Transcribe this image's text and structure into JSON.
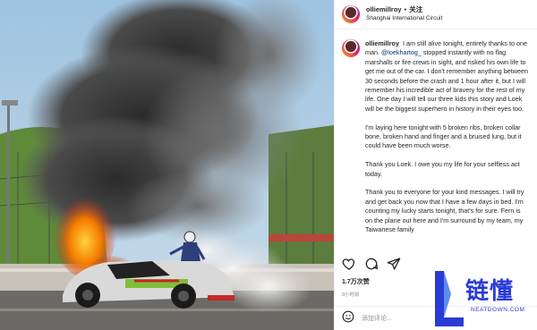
{
  "post": {
    "username": "olliemillroy",
    "follow_label": "关注",
    "separator": "•",
    "location": "Shanghai International Circuit",
    "caption": {
      "username": "olliemillroy",
      "part1_before": "I am still alive tonight, entirely thanks to one man.",
      "mention": "@loekhartog_",
      "part1_after": "stopped instantly with no flag marshalls or fire crews in sight, and risked his own life to get me out of the car. I don't remember anything between 30 seconds before the crash and 1 hour after it, but I will remember his incredible act of bravery for the rest of my life. One day I will tell our three kids this story and Loek will be the biggest superhero in history in their eyes too.",
      "paragraph2": "I'm laying here tonight with 5 broken ribs, broken collar bone, broken hand and finger and a bruised lung, but it could have been much worse.",
      "paragraph3": "Thank you Loek. I owe you my life for your selfless act today.",
      "paragraph4": "Thank you to everyone for your kind messages. I will try and get back you now that I have a few days in bed. I'm counting my lucky starts tonight, that's for sure. Fern is on the plane out here and I'm surround by my team, my Taiwanese family"
    },
    "likes": "1.7万次赞",
    "time_ago": "8小时前",
    "comment_placeholder": "添加评论..."
  },
  "icons": {
    "like": "heart-icon",
    "comment": "comment-icon",
    "share": "share-icon",
    "emoji": "emoji-icon"
  },
  "watermark": {
    "title": "链懂",
    "subtitle": "NEATDOWN.COM"
  },
  "colors": {
    "mention": "#00376b",
    "watermark": "#2a3bd6",
    "text": "#262626",
    "muted": "#8e8e8e"
  }
}
